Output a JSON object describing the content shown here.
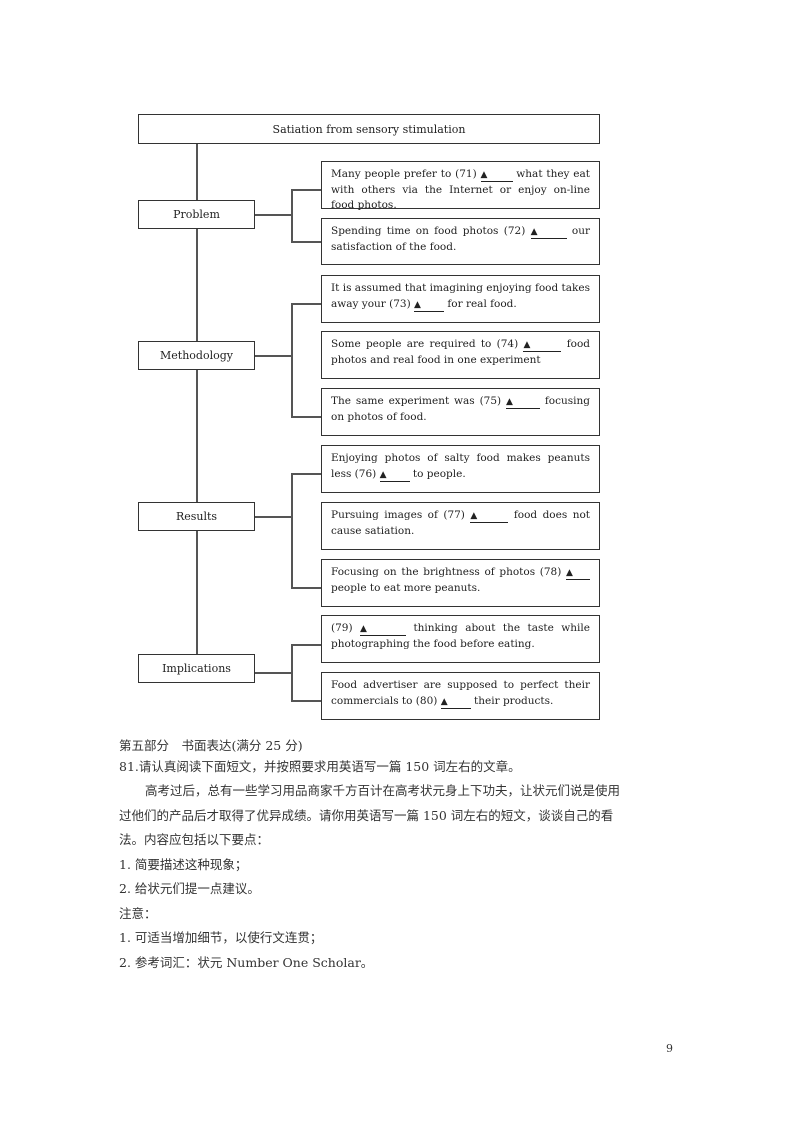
{
  "diagram": {
    "title": "Satiation from sensory stimulation",
    "blank_marker": "▲",
    "categories": [
      {
        "label": "Problem",
        "items": [
          {
            "before": "Many people prefer to (71) ",
            "after": " what they eat with others via the Internet or enjoy on-line food photos."
          },
          {
            "before": "Spending time on food photos (72) ",
            "after": " our satisfaction of the food."
          }
        ]
      },
      {
        "label": "Methodology",
        "items": [
          {
            "before": "It is assumed that imagining enjoying food takes away your (73) ",
            "after": " for real food."
          },
          {
            "before": "Some people are required to (74) ",
            "after": " food photos and real food in one experiment"
          },
          {
            "before": "The same experiment was (75) ",
            "after": " focusing on photos of food."
          }
        ]
      },
      {
        "label": "Results",
        "items": [
          {
            "before": "Enjoying photos of salty food makes peanuts less (76) ",
            "after": " to people."
          },
          {
            "before": "Pursuing images of (77) ",
            "after": " food does not cause satiation."
          },
          {
            "before": "Focusing on the brightness of photos (78) ",
            "after": " people to eat more peanuts."
          }
        ]
      },
      {
        "label": "Implications",
        "items": [
          {
            "before": "(79) ",
            "after": " thinking about the taste while photographing the food before eating."
          },
          {
            "before": "Food advertiser are supposed to perfect their commercials to (80) ",
            "after": " their products."
          }
        ]
      }
    ]
  },
  "writing_section": {
    "heading": "第五部分　书面表达(满分 25 分)",
    "question": "81.请认真阅读下面短文，并按照要求用英语写一篇 150 词左右的文章。",
    "paragraph_line1": "高考过后，总有一些学习用品商家千方百计在高考状元身上下功夫，让状元们说是使用",
    "paragraph_line2": "过他们的产品后才取得了优异成绩。请你用英语写一篇 150 词左右的短文，谈谈自己的看",
    "paragraph_line3": "法。内容应包括以下要点：",
    "points": [
      "1. 简要描述这种现象；",
      "2. 给状元们提一点建议。"
    ],
    "notes_label": "注意：",
    "notes": [
      "1. 可适当增加细节，以使行文连贯；",
      "2. 参考词汇：状元 Number One Scholar。"
    ]
  },
  "page_number": "9"
}
